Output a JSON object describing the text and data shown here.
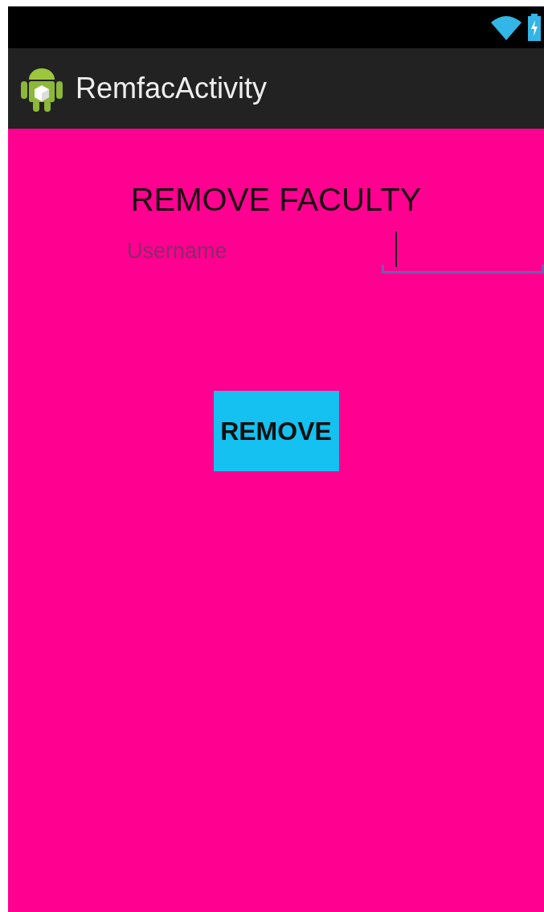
{
  "app_bar": {
    "title": "RemfacActivity"
  },
  "heading": "REMOVE FACULTY",
  "username": {
    "label": "Username",
    "focused": true
  },
  "button": {
    "label": "REMOVE"
  }
}
